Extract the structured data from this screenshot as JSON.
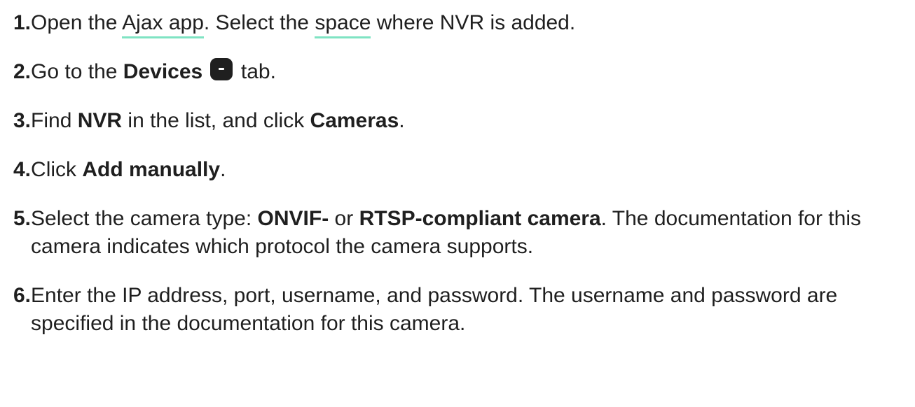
{
  "steps": [
    {
      "num": "1.",
      "t1": " Open the ",
      "link1": "Ajax app",
      "t2": ". Select the ",
      "link2": "space",
      "t3": " where NVR is added."
    },
    {
      "num": "2.",
      "t1": " Go to the ",
      "b1": "Devices",
      "icon": "devices-tab-icon",
      "t2": " tab."
    },
    {
      "num": "3.",
      "t1": " Find ",
      "b1": "NVR",
      "t2": " in the list, and click ",
      "b2": "Cameras",
      "t3": "."
    },
    {
      "num": "4.",
      "t1": " Click ",
      "b1": "Add manually",
      "t2": "."
    },
    {
      "num": "5.",
      "t1": " Select the camera type: ",
      "b1": "ONVIF-",
      "t2": " or ",
      "b2": "RTSP-compliant camera",
      "t3": ". The documentation for this camera indicates which protocol the camera supports."
    },
    {
      "num": "6.",
      "t1": " Enter the IP address, port, username, and password. The username and password are specified in the documentation for this camera."
    }
  ],
  "colors": {
    "text": "#1f1f1f",
    "link_underline": "#7fe3c3",
    "icon_bg": "#1f1f1f"
  }
}
